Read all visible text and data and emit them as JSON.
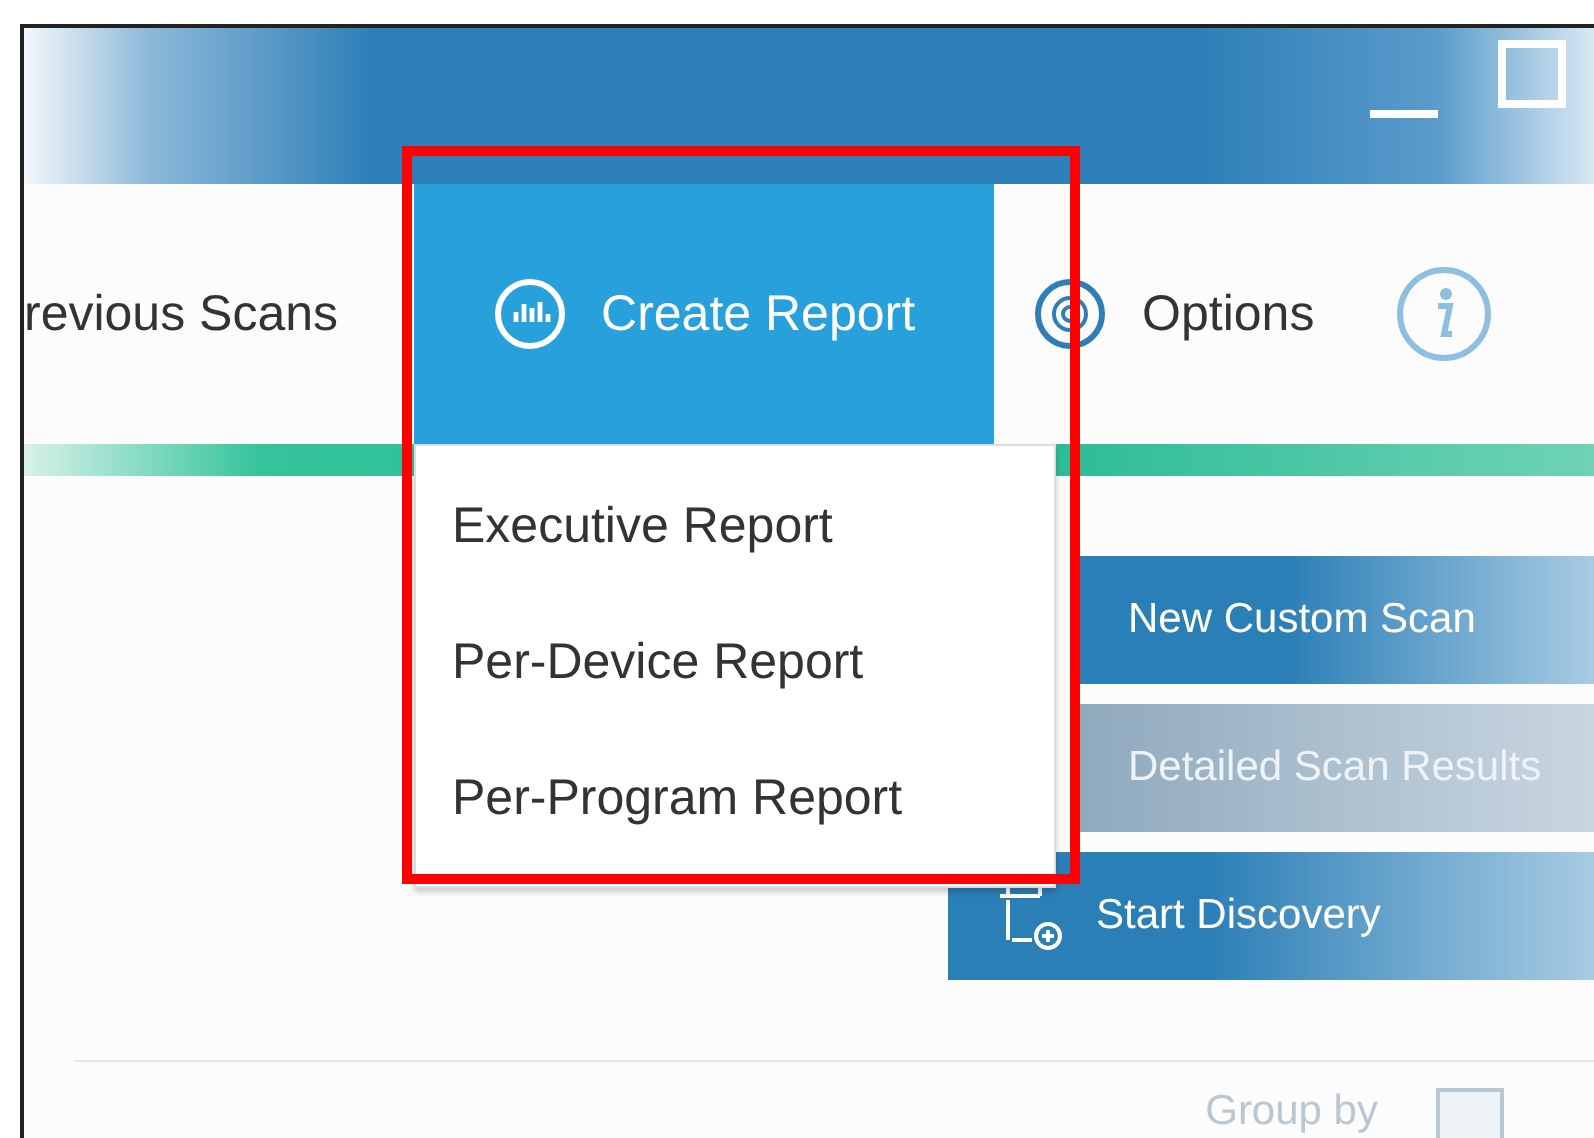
{
  "nav": {
    "tabs": [
      {
        "label": "revious Scans",
        "kind": "text",
        "selected": false
      },
      {
        "label": "Create Report",
        "kind": "chart",
        "selected": true
      },
      {
        "label": "Options",
        "kind": "gear",
        "selected": false
      },
      {
        "kind": "info",
        "selected": false
      }
    ]
  },
  "dropdown": {
    "items": [
      "Executive Report",
      "Per-Device Report",
      "Per-Program Report"
    ]
  },
  "actions": [
    {
      "label": "New Custom Scan",
      "disabled": false
    },
    {
      "label": "Detailed Scan Results",
      "disabled": true
    },
    {
      "label": "Start Discovery",
      "disabled": false
    }
  ],
  "group_by": {
    "label": "Group by"
  }
}
